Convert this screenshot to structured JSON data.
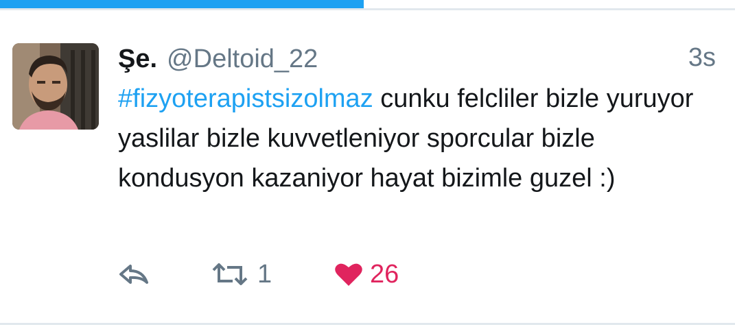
{
  "progress": {
    "fraction": 0.495
  },
  "tweet": {
    "avatar": "user-avatar-photo",
    "display_name": "Şe.",
    "handle": "@Deltoid_22",
    "timestamp": "3s",
    "hashtag": "#fizyoterapistsizolmaz",
    "text_after_hashtag": " cunku felcliler bizle yuruyor yaslilar bizle kuvvetleniyor sporcular bizle kondusyon kazaniyor hayat bizimle guzel :)"
  },
  "actions": {
    "reply_icon": "reply-icon",
    "retweet_icon": "retweet-icon",
    "retweet_count": "1",
    "like_icon": "heart-icon",
    "like_count": "26"
  },
  "colors": {
    "accent": "#1da1f2",
    "like": "#e0245e",
    "secondary_text": "#657786",
    "primary_text": "#14171a"
  }
}
